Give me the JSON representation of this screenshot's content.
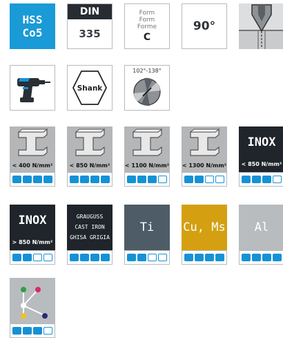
{
  "row1": {
    "material": {
      "line1": "HSS",
      "line2": "Co5"
    },
    "standard": {
      "title": "DIN",
      "number": "335"
    },
    "form": {
      "line1": "Form",
      "line2": "Form",
      "line3": "Forme",
      "letter": "C"
    },
    "angle": "90°",
    "tip_icon": "countersink-tip-icon"
  },
  "row2": {
    "drill_icon": "hand-drill-icon",
    "shank": "Shank",
    "point_angle": "102°-138°"
  },
  "materials": [
    {
      "label": "< 400 N/mm²",
      "rating": 4
    },
    {
      "label": "< 850 N/mm²",
      "rating": 4
    },
    {
      "label": "< 1100 N/mm²",
      "rating": 3
    },
    {
      "label": "< 1300 N/mm²",
      "rating": 2
    },
    {
      "title": "INOX",
      "label": "< 850 N/mm²",
      "rating": 3
    },
    {
      "title": "INOX",
      "label": "> 850 N/mm²",
      "rating": 2
    },
    {
      "lines": [
        "GRAUGUSS",
        "CAST IRON",
        "GHISA GRIGIA"
      ],
      "rating": 4
    },
    {
      "title": "Ti",
      "rating": 2
    },
    {
      "title": "Cu, Ms",
      "rating": 4
    },
    {
      "title": "Al",
      "rating": 4
    },
    {
      "title": "",
      "rating": 3
    }
  ],
  "colors": {
    "accent_blue": "#1592d6",
    "hss_blue": "#1a9ad6",
    "dark": "#1f252b",
    "ti": "#4d5c66",
    "cu": "#d4a012",
    "al": "#b9bcbf",
    "steel": "#b4b6b8"
  }
}
